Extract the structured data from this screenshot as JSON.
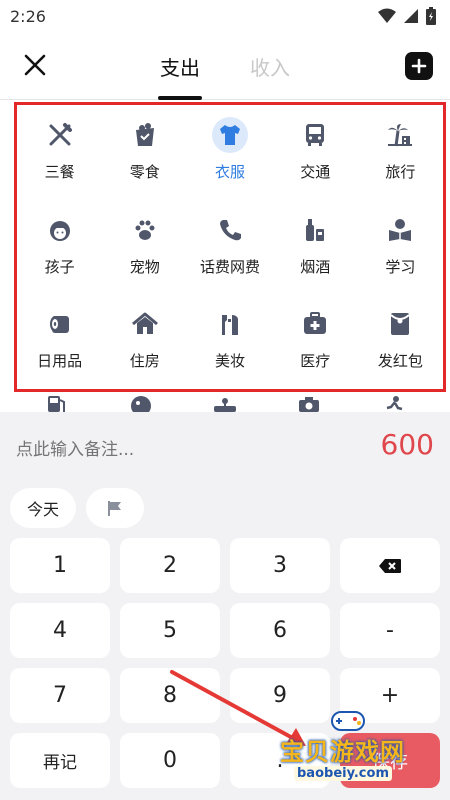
{
  "status_bar": {
    "time": "2:26"
  },
  "header": {
    "tabs": [
      "支出",
      "收入"
    ],
    "active_tab": "支出"
  },
  "categories": [
    {
      "label": "三餐",
      "icon": "utensils-icon"
    },
    {
      "label": "零食",
      "icon": "snack-icon"
    },
    {
      "label": "衣服",
      "icon": "shirt-icon",
      "selected": true
    },
    {
      "label": "交通",
      "icon": "bus-icon"
    },
    {
      "label": "旅行",
      "icon": "palm-tree-icon"
    },
    {
      "label": "孩子",
      "icon": "child-icon"
    },
    {
      "label": "宠物",
      "icon": "paw-icon"
    },
    {
      "label": "话费网费",
      "icon": "phone-icon"
    },
    {
      "label": "烟酒",
      "icon": "bottle-icon"
    },
    {
      "label": "学习",
      "icon": "book-icon"
    },
    {
      "label": "日用品",
      "icon": "tissue-roll-icon"
    },
    {
      "label": "住房",
      "icon": "house-icon"
    },
    {
      "label": "美妆",
      "icon": "makeup-icon"
    },
    {
      "label": "医疗",
      "icon": "medical-kit-icon"
    },
    {
      "label": "发红包",
      "icon": "red-envelope-icon"
    }
  ],
  "entry": {
    "note_placeholder": "点此输入备注...",
    "amount": "600"
  },
  "chips": {
    "today": "今天"
  },
  "keypad": {
    "row1": [
      "1",
      "2",
      "3"
    ],
    "row2": [
      "4",
      "5",
      "6",
      "-"
    ],
    "row3": [
      "7",
      "8",
      "9",
      "+"
    ],
    "row4": [
      "再记",
      "0",
      ".",
      "保存"
    ]
  },
  "watermark": {
    "text": "宝贝游戏网",
    "url": "baobeiy.com"
  },
  "colors": {
    "accent": "#2f7de1",
    "amount": "#e0474c",
    "highlight_box": "#e22828",
    "save": "#e85b62"
  }
}
